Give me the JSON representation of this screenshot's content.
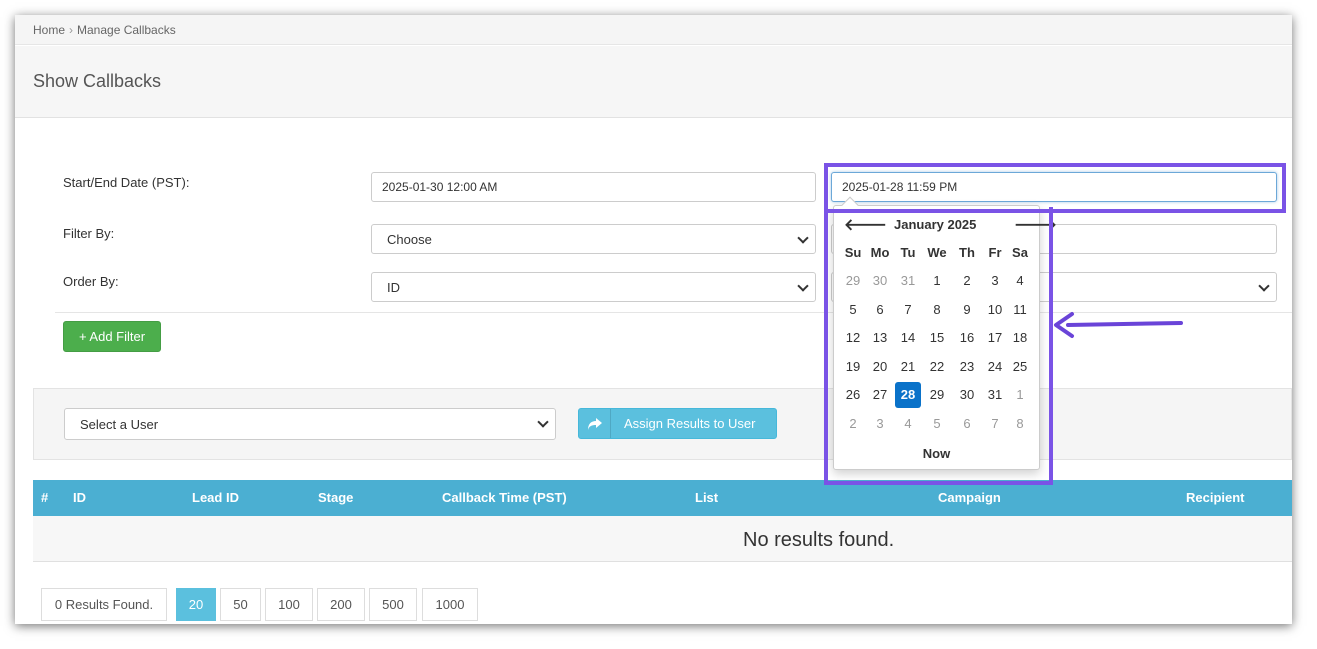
{
  "breadcrumb": {
    "home": "Home",
    "separator": "›",
    "current": "Manage Callbacks"
  },
  "page_title": "Show Callbacks",
  "form": {
    "date_label": "Start/End Date (PST):",
    "start_date": "2025-01-30 12:00 AM",
    "end_date": "2025-01-28 11:59 PM",
    "filter_label": "Filter By:",
    "filter_value": "Choose",
    "order_label": "Order By:",
    "order_value": "ID",
    "add_filter": "+ Add Filter"
  },
  "assign": {
    "user_select": "Select a User",
    "button": "Assign Results to User",
    "icon": "share-arrow-icon"
  },
  "table": {
    "columns": [
      "#",
      "ID",
      "Lead ID",
      "Stage",
      "Callback Time (PST)",
      "List",
      "Campaign",
      "Recipient"
    ],
    "empty": "No results found."
  },
  "pager": {
    "count": "0 Results Found.",
    "sizes": [
      "20",
      "50",
      "100",
      "200",
      "500",
      "1000"
    ],
    "active": "20"
  },
  "datepicker": {
    "month": "January 2025",
    "prev": "🡐",
    "next": "🡒",
    "weekdays": [
      "Su",
      "Mo",
      "Tu",
      "We",
      "Th",
      "Fr",
      "Sa"
    ],
    "weeks": [
      [
        "29",
        "30",
        "31",
        "1",
        "2",
        "3",
        "4"
      ],
      [
        "5",
        "6",
        "7",
        "8",
        "9",
        "10",
        "11"
      ],
      [
        "12",
        "13",
        "14",
        "15",
        "16",
        "17",
        "18"
      ],
      [
        "19",
        "20",
        "21",
        "22",
        "23",
        "24",
        "25"
      ],
      [
        "26",
        "27",
        "28",
        "29",
        "30",
        "31",
        "1"
      ],
      [
        "2",
        "3",
        "4",
        "5",
        "6",
        "7",
        "8"
      ]
    ],
    "selected": "28",
    "now": "Now"
  },
  "colors": {
    "highlight": "#7a53e6",
    "accent": "#5bc0de",
    "success": "#4cae4c",
    "table_header": "#4bafd2",
    "selected_day": "#0a72c9"
  }
}
